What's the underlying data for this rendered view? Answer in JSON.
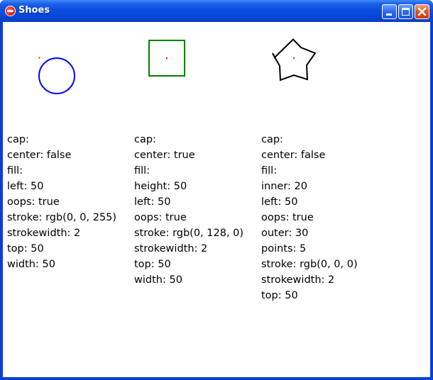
{
  "window": {
    "title": "Shoes",
    "icon": "shoes-app-icon",
    "controls": [
      "minimize-icon",
      "maximize-icon",
      "close-icon"
    ]
  },
  "shapes": [
    {
      "kind": "oval",
      "color": "#0000ff",
      "properties": [
        {
          "key": "cap",
          "value": ""
        },
        {
          "key": "center",
          "value": "false"
        },
        {
          "key": "fill",
          "value": ""
        },
        {
          "key": "left",
          "value": "50"
        },
        {
          "key": "oops",
          "value": "true"
        },
        {
          "key": "stroke",
          "value": "rgb(0, 0, 255)"
        },
        {
          "key": "strokewidth",
          "value": "2"
        },
        {
          "key": "top",
          "value": "50"
        },
        {
          "key": "width",
          "value": "50"
        }
      ]
    },
    {
      "kind": "rect",
      "color": "#008000",
      "properties": [
        {
          "key": "cap",
          "value": ""
        },
        {
          "key": "center",
          "value": "true"
        },
        {
          "key": "fill",
          "value": ""
        },
        {
          "key": "height",
          "value": "50"
        },
        {
          "key": "left",
          "value": "50"
        },
        {
          "key": "oops",
          "value": "true"
        },
        {
          "key": "stroke",
          "value": "rgb(0, 128, 0)"
        },
        {
          "key": "strokewidth",
          "value": "2"
        },
        {
          "key": "top",
          "value": "50"
        },
        {
          "key": "width",
          "value": "50"
        }
      ]
    },
    {
      "kind": "star",
      "color": "#000000",
      "properties": [
        {
          "key": "cap",
          "value": ""
        },
        {
          "key": "center",
          "value": "false"
        },
        {
          "key": "fill",
          "value": ""
        },
        {
          "key": "inner",
          "value": "20"
        },
        {
          "key": "left",
          "value": "50"
        },
        {
          "key": "oops",
          "value": "true"
        },
        {
          "key": "outer",
          "value": "30"
        },
        {
          "key": "points",
          "value": "5"
        },
        {
          "key": "stroke",
          "value": "rgb(0, 0, 0)"
        },
        {
          "key": "strokewidth",
          "value": "2"
        },
        {
          "key": "top",
          "value": "50"
        }
      ]
    }
  ]
}
